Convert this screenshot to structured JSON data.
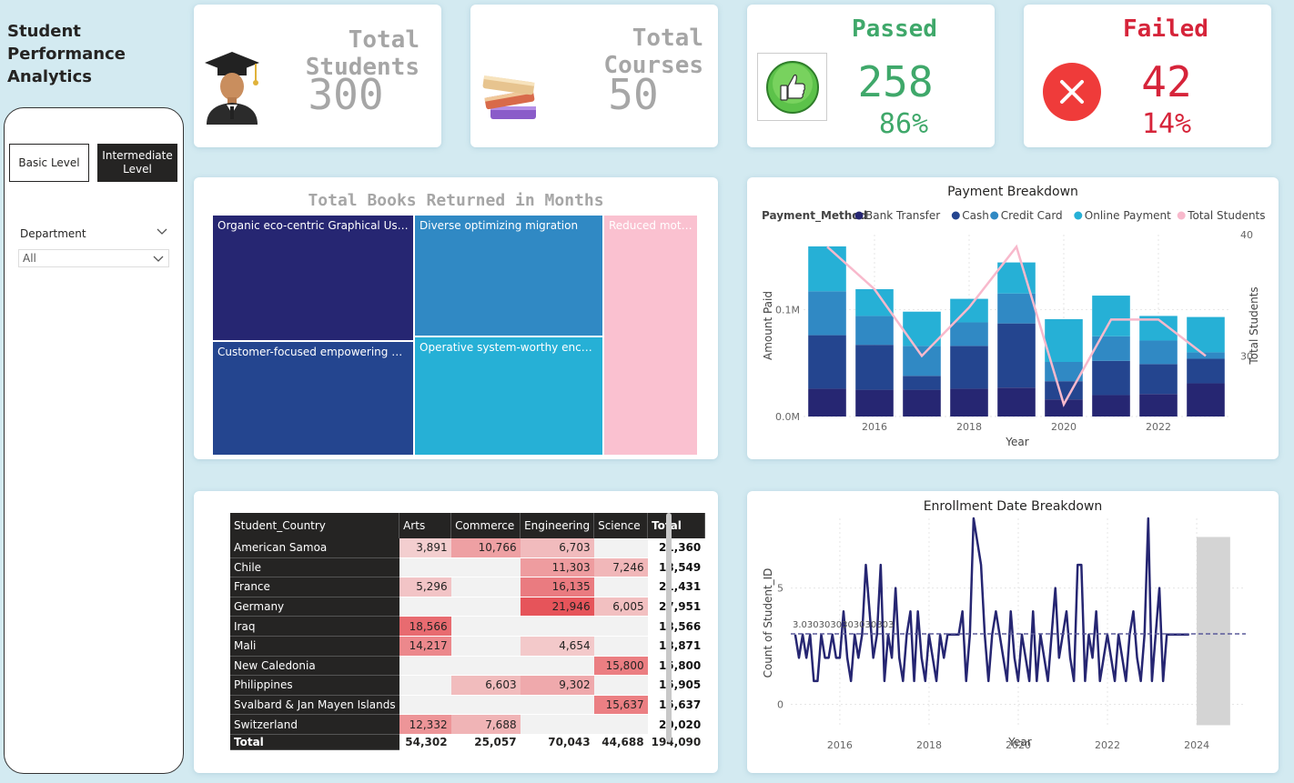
{
  "app": {
    "title": "Student\nPerformance\nAnalytics"
  },
  "levels": {
    "basic": "Basic Level",
    "intermediate": "Intermediate Level"
  },
  "department": {
    "label": "Department",
    "value": "All"
  },
  "kpis": {
    "students": {
      "label": "Total Students",
      "value": "300",
      "icon": "graduate-icon"
    },
    "courses": {
      "label": "Total Courses",
      "value": "50",
      "icon": "books-icon"
    },
    "passed": {
      "label": "Passed",
      "value": "258",
      "pct": "86%",
      "icon": "thumbs-up-icon",
      "color": "#3fa86a"
    },
    "failed": {
      "label": "Failed",
      "value": "42",
      "pct": "14%",
      "icon": "close-icon",
      "color": "#d6243a"
    }
  },
  "treemap": {
    "title": "Total Books Returned in Months",
    "cells": [
      {
        "label": "Organic eco-centric Graphical User Interface",
        "color": "#262672"
      },
      {
        "label": "Customer-focused empowering projection",
        "color": "#24458f"
      },
      {
        "label": "Diverse optimizing migration",
        "color": "#3089c4"
      },
      {
        "label": "Operative system-worthy encoding",
        "color": "#26b0d6"
      },
      {
        "label": "Reduced motivating",
        "color": "#fac1d0"
      }
    ]
  },
  "matrix": {
    "headers": [
      "Student_Country",
      "Arts",
      "Commerce",
      "Engineering",
      "Science",
      "Total"
    ],
    "rows": [
      {
        "country": "American Samoa",
        "arts": "3,891",
        "commerce": "10,766",
        "engineering": "6,703",
        "science": "",
        "total": "21,360"
      },
      {
        "country": "Chile",
        "arts": "",
        "commerce": "",
        "engineering": "11,303",
        "science": "7,246",
        "total": "18,549"
      },
      {
        "country": "France",
        "arts": "5,296",
        "commerce": "",
        "engineering": "16,135",
        "science": "",
        "total": "21,431"
      },
      {
        "country": "Germany",
        "arts": "",
        "commerce": "",
        "engineering": "21,946",
        "science": "6,005",
        "total": "27,951"
      },
      {
        "country": "Iraq",
        "arts": "18,566",
        "commerce": "",
        "engineering": "",
        "science": "",
        "total": "18,566"
      },
      {
        "country": "Mali",
        "arts": "14,217",
        "commerce": "",
        "engineering": "4,654",
        "science": "",
        "total": "18,871"
      },
      {
        "country": "New Caledonia",
        "arts": "",
        "commerce": "",
        "engineering": "",
        "science": "15,800",
        "total": "15,800"
      },
      {
        "country": "Philippines",
        "arts": "",
        "commerce": "6,603",
        "engineering": "9,302",
        "science": "",
        "total": "15,905"
      },
      {
        "country": "Svalbard & Jan Mayen Islands",
        "arts": "",
        "commerce": "",
        "engineering": "",
        "science": "15,637",
        "total": "15,637"
      },
      {
        "country": "Switzerland",
        "arts": "12,332",
        "commerce": "7,688",
        "engineering": "",
        "science": "",
        "total": "20,020"
      }
    ],
    "total": {
      "country": "Total",
      "arts": "54,302",
      "commerce": "25,057",
      "engineering": "70,043",
      "science": "44,688",
      "total": "194,090"
    }
  },
  "chart_data": [
    {
      "type": "bar",
      "title": "Payment Breakdown",
      "legend_title": "Payment_Method",
      "legend_position": "top",
      "xlabel": "Year",
      "ylabel": "Amount Paid",
      "y2label": "Total Students",
      "x": [
        2015,
        2016,
        2017,
        2018,
        2019,
        2020,
        2021,
        2022,
        2023
      ],
      "x_ticks": [
        "2016",
        "2018",
        "2020",
        "2022"
      ],
      "y_ticks": [
        "0.0M",
        "0.1M"
      ],
      "y2_ticks": [
        "30",
        "40"
      ],
      "ylim": [
        0,
        0.17
      ],
      "y2lim": [
        25,
        40
      ],
      "series": [
        {
          "name": "Bank Transfer",
          "color": "#262672",
          "values": [
            0.026,
            0.025,
            0.025,
            0.026,
            0.027,
            0.016,
            0.02,
            0.021,
            0.031
          ]
        },
        {
          "name": "Cash",
          "color": "#24458f",
          "values": [
            0.05,
            0.042,
            0.013,
            0.04,
            0.06,
            0.017,
            0.032,
            0.028,
            0.023
          ]
        },
        {
          "name": "Credit Card",
          "color": "#3089c4",
          "values": [
            0.041,
            0.027,
            0.028,
            0.022,
            0.028,
            0.018,
            0.023,
            0.022,
            0.006
          ]
        },
        {
          "name": "Online Payment",
          "color": "#26b0d6",
          "values": [
            0.042,
            0.025,
            0.032,
            0.022,
            0.029,
            0.04,
            0.038,
            0.023,
            0.033
          ]
        }
      ],
      "line": {
        "name": "Total Students",
        "color": "#f8b9cc",
        "values": [
          39,
          35.5,
          30,
          34,
          39,
          26,
          33,
          33,
          30
        ]
      }
    },
    {
      "type": "line",
      "title": "Enrollment Date Breakdown",
      "xlabel": "Year",
      "ylabel": "Count of Student_ID",
      "x_ticks": [
        "2016",
        "2018",
        "2020",
        "2022",
        "2024"
      ],
      "y_ticks": [
        "0",
        "5"
      ],
      "xlim": [
        2014.9,
        2025.1
      ],
      "ylim": [
        -1,
        8
      ],
      "average_label": "3.0303030303030303",
      "average": 3.03,
      "forecast_band": [
        2024,
        2024.75
      ],
      "series": [
        {
          "color": "#262672",
          "x_start": 2015.0,
          "x_step": 0.0833,
          "values": [
            3,
            2,
            3,
            2,
            3,
            1,
            1,
            3,
            2,
            2,
            3,
            2,
            2,
            4,
            2,
            1,
            3,
            2,
            3,
            6,
            4,
            2,
            3,
            6,
            1,
            3,
            2,
            5,
            2,
            1,
            3,
            4,
            1,
            4,
            2,
            1,
            3,
            2,
            1,
            3,
            2,
            3,
            3,
            3,
            3,
            4,
            1,
            3,
            8,
            7,
            6,
            3,
            1,
            3,
            4,
            3,
            2,
            1,
            4,
            2,
            1,
            3,
            2,
            1,
            4,
            1,
            3,
            2,
            1,
            3,
            5,
            2,
            3,
            4,
            2,
            1,
            6,
            6,
            1,
            3,
            2,
            4,
            1,
            2,
            3,
            2,
            1,
            3,
            2,
            1,
            3,
            4,
            2,
            1,
            3,
            8,
            1,
            3,
            5,
            1,
            3,
            3,
            3,
            3,
            3,
            3,
            3
          ]
        }
      ]
    }
  ]
}
